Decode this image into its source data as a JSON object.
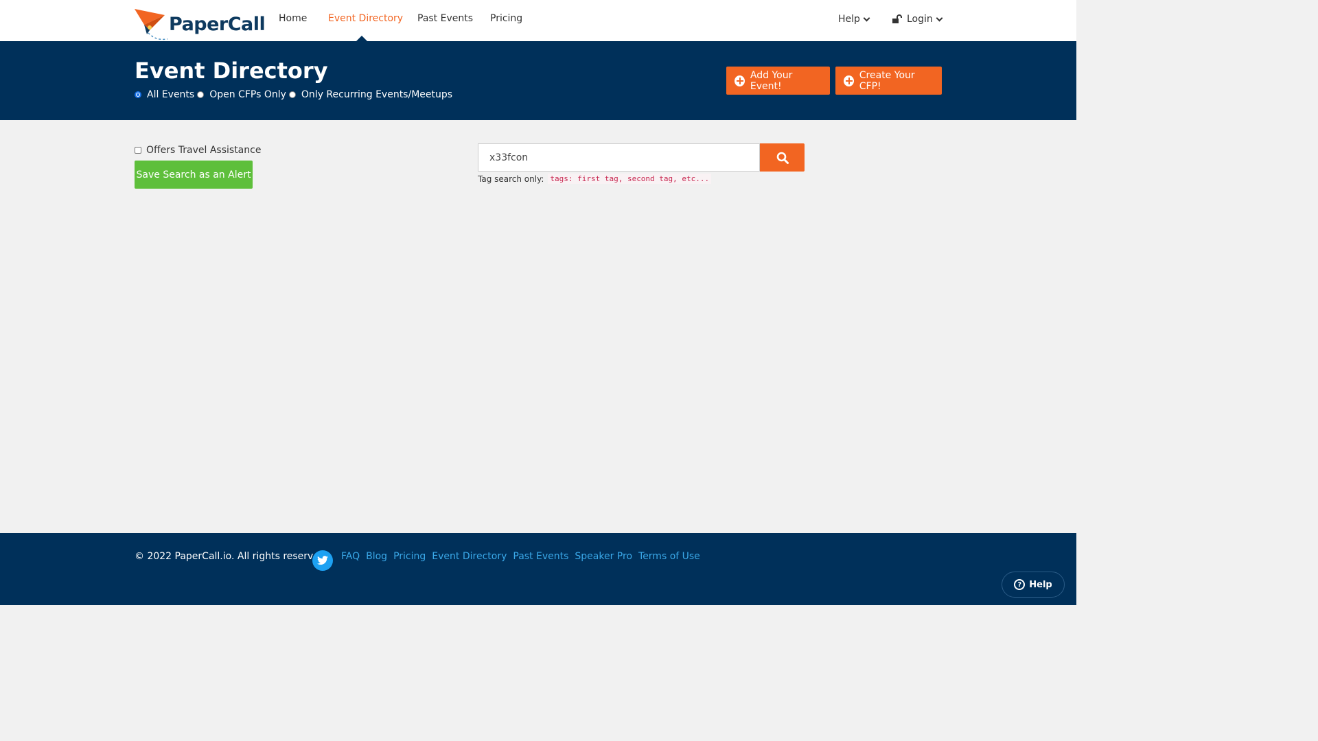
{
  "nav": {
    "logo_text": "PaperCall",
    "links": [
      "Home",
      "Event Directory",
      "Past Events",
      "Pricing"
    ],
    "active": "Event Directory",
    "help_label": "Help",
    "login_label": "Login"
  },
  "banner": {
    "title": "Event Directory",
    "filters": [
      "All Events",
      "Open CFPs Only",
      "Only Recurring Events/Meetups"
    ],
    "selected_filter": "All Events",
    "add_event_label": "Add Your Event!",
    "create_cfp_label": "Create Your CFP!"
  },
  "search": {
    "travel_assistance_label": "Offers Travel Assistance",
    "travel_assistance_checked": false,
    "save_alert_label": "Save Search as an Alert",
    "query_value": "x33fcon",
    "tag_hint_label": "Tag search only:",
    "tag_hint_example": "tags: first tag, second tag, etc..."
  },
  "footer": {
    "copyright": "© 2022 PaperCall.io. All rights reserved.",
    "links": [
      "FAQ",
      "Blog",
      "Pricing",
      "Event Directory",
      "Past Events",
      "Speaker Pro",
      "Terms of Use"
    ],
    "help_widget_label": "Help"
  },
  "colors": {
    "brand_navy": "#00305a",
    "accent_orange": "#f26522",
    "success_green": "#5ebf3b",
    "link_blue": "#3aa8e8"
  }
}
